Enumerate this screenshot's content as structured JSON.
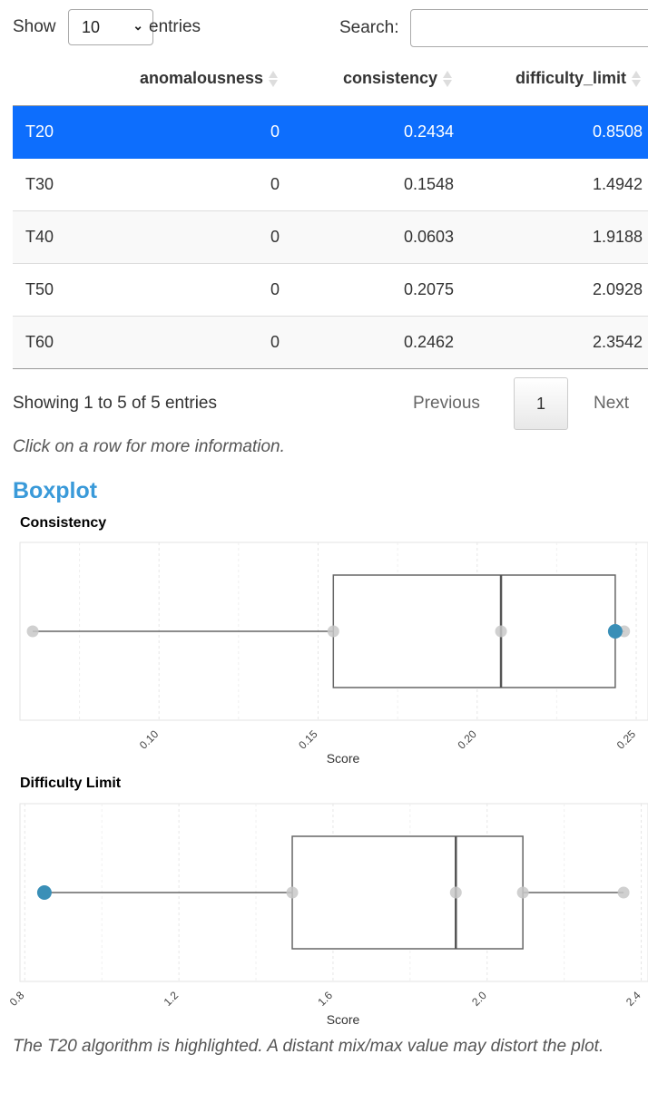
{
  "controls": {
    "show_label": "Show",
    "entries_value": "10",
    "entries_label": "entries",
    "search_label": "Search:",
    "search_value": ""
  },
  "table": {
    "headers": [
      "",
      "anomalousness",
      "consistency",
      "difficulty_limit"
    ],
    "rows": [
      {
        "name": "T20",
        "anomalousness": "0",
        "consistency": "0.2434",
        "difficulty_limit": "0.8508",
        "selected": true
      },
      {
        "name": "T30",
        "anomalousness": "0",
        "consistency": "0.1548",
        "difficulty_limit": "1.4942",
        "selected": false
      },
      {
        "name": "T40",
        "anomalousness": "0",
        "consistency": "0.0603",
        "difficulty_limit": "1.9188",
        "selected": false
      },
      {
        "name": "T50",
        "anomalousness": "0",
        "consistency": "0.2075",
        "difficulty_limit": "2.0928",
        "selected": false
      },
      {
        "name": "T60",
        "anomalousness": "0",
        "consistency": "0.2462",
        "difficulty_limit": "2.3542",
        "selected": false
      }
    ],
    "colors": {
      "selected_bg": "#0d6efd",
      "selected_text": "#ffffff"
    }
  },
  "pagination": {
    "info": "Showing 1 to 5 of 5 entries",
    "previous": "Previous",
    "current_page": "1",
    "next": "Next"
  },
  "hint": "Click on a row for more information.",
  "section_title": "Boxplot",
  "chart_data": [
    {
      "type": "boxplot",
      "title": "Consistency",
      "xlabel": "Score",
      "ylabel": "",
      "xlim": [
        0.0563,
        0.2537
      ],
      "ticks": [
        0.1,
        0.15,
        0.2,
        0.25
      ],
      "tick_labels": [
        "0.10",
        "0.15",
        "0.20",
        "0.25"
      ],
      "box": {
        "min": 0.0603,
        "q1": 0.1548,
        "median": 0.2075,
        "q3": 0.2434,
        "max": 0.2462
      },
      "points": [
        0.0603,
        0.1548,
        0.2075,
        0.2434,
        0.2462
      ],
      "highlighted": 0.2434,
      "highlight_color": "#3a8fb7",
      "point_color": "#c8c8c8",
      "grid": true
    },
    {
      "type": "boxplot",
      "title": "Difficulty Limit",
      "xlabel": "Score",
      "ylabel": "",
      "xlim": [
        0.7874,
        2.4176
      ],
      "ticks": [
        0.8,
        1.2,
        1.6,
        2.0,
        2.4
      ],
      "tick_labels": [
        "0.8",
        "1.2",
        "1.6",
        "2.0",
        "2.4"
      ],
      "box": {
        "min": 0.8508,
        "q1": 1.4942,
        "median": 1.9188,
        "q3": 2.0928,
        "max": 2.3542
      },
      "points": [
        0.8508,
        1.4942,
        1.9188,
        2.0928,
        2.3542
      ],
      "highlighted": 0.8508,
      "highlight_color": "#3a8fb7",
      "point_color": "#c8c8c8",
      "grid": true
    }
  ],
  "caption": "The T20 algorithm is highlighted. A distant mix/max value may distort the plot."
}
